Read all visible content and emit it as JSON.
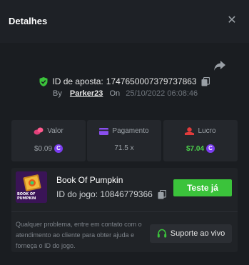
{
  "header": {
    "title": "Detalhes"
  },
  "bet": {
    "id_label": "ID de aposta:",
    "id_value": "1747650007379737863",
    "by_label": "By",
    "user": "Parker23",
    "on_label": "On",
    "date": "25/10/2022 06:08:46"
  },
  "stats": {
    "valor": {
      "label": "Valor",
      "value": "$0.09",
      "coin": "C"
    },
    "pagamento": {
      "label": "Pagamento",
      "value": "71.5 x"
    },
    "lucro": {
      "label": "Lucro",
      "value": "$7.04",
      "coin": "C"
    }
  },
  "game": {
    "thumb_text": "BOOK OF PUMPKIN",
    "name": "Book Of Pumpkin",
    "id_label": "ID do jogo:",
    "id_value": "10846779366",
    "try_label": "Teste já"
  },
  "support": {
    "help_text": "Qualquer problema, entre em contato com o atendimento ao cliente para obter ajuda e forneça o ID do jogo.",
    "button_label": "Suporte ao vivo"
  },
  "colors": {
    "accent_green": "#3bc33b",
    "profit_green": "#4bd04b",
    "coin_purple": "#7b3df0",
    "valor_pink": "#e0407a",
    "pagamento_purple": "#8a4ff0",
    "lucro_red": "#e03b3b"
  }
}
